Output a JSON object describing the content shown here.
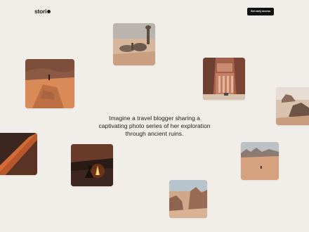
{
  "header": {
    "logo_text": "stori",
    "cta_label": "Get early access"
  },
  "hero": {
    "text": "Imagine a travel blogger sharing a captivating photo series of her exploration through ancient ruins."
  },
  "gallery": {
    "photos": [
      {
        "subject": "camels resting in the desert"
      },
      {
        "subject": "hiker on sandstone rock formation"
      },
      {
        "subject": "ancient carved facade in rock"
      },
      {
        "subject": "rocky desert outcrops"
      },
      {
        "subject": "red sand dune ridge"
      },
      {
        "subject": "person by campfire at night"
      },
      {
        "subject": "lone figure in wide desert"
      },
      {
        "subject": "desert canyon rocks"
      }
    ]
  },
  "colors": {
    "background": "#f1ede8",
    "text": "#1c1c1c",
    "button_bg": "#111111",
    "button_text": "#ffffff"
  }
}
